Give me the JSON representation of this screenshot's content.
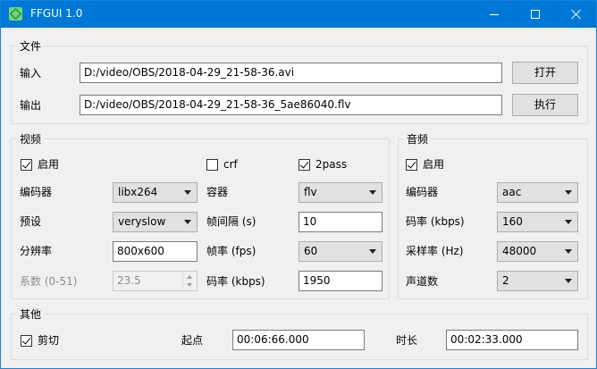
{
  "window": {
    "title": "FFGUI 1.0"
  },
  "file": {
    "title": "文件",
    "input_label": "输入",
    "input_value": "D:/video/OBS/2018-04-29_21-58-36.avi",
    "open_button": "打开",
    "output_label": "输出",
    "output_value": "D:/video/OBS/2018-04-29_21-58-36_5ae86040.flv",
    "run_button": "执行"
  },
  "video": {
    "title": "视频",
    "enable_label": "启用",
    "enable_checked": true,
    "crf_label": "crf",
    "crf_checked": false,
    "twopass_label": "2pass",
    "twopass_checked": true,
    "encoder_label": "编码器",
    "encoder_value": "libx264",
    "container_label": "容器",
    "container_value": "flv",
    "preset_label": "预设",
    "preset_value": "veryslow",
    "keyframe_label": "帧间隔 (s)",
    "keyframe_value": "10",
    "resolution_label": "分辨率",
    "resolution_value": "800x600",
    "fps_label": "帧率 (fps)",
    "fps_value": "60",
    "coef_label": "系数 (0-51)",
    "coef_value": "23.5",
    "bitrate_label": "码率 (kbps)",
    "bitrate_value": "1950"
  },
  "audio": {
    "title": "音频",
    "enable_label": "启用",
    "enable_checked": true,
    "encoder_label": "编码器",
    "encoder_value": "aac",
    "bitrate_label": "码率 (kbps)",
    "bitrate_value": "160",
    "samplerate_label": "采样率 (Hz)",
    "samplerate_value": "48000",
    "channels_label": "声道数",
    "channels_value": "2"
  },
  "other": {
    "title": "其他",
    "cut_label": "剪切",
    "cut_checked": true,
    "start_label": "起点",
    "start_value": "00:06:66.000",
    "duration_label": "时长",
    "duration_value": "00:02:33.000"
  }
}
